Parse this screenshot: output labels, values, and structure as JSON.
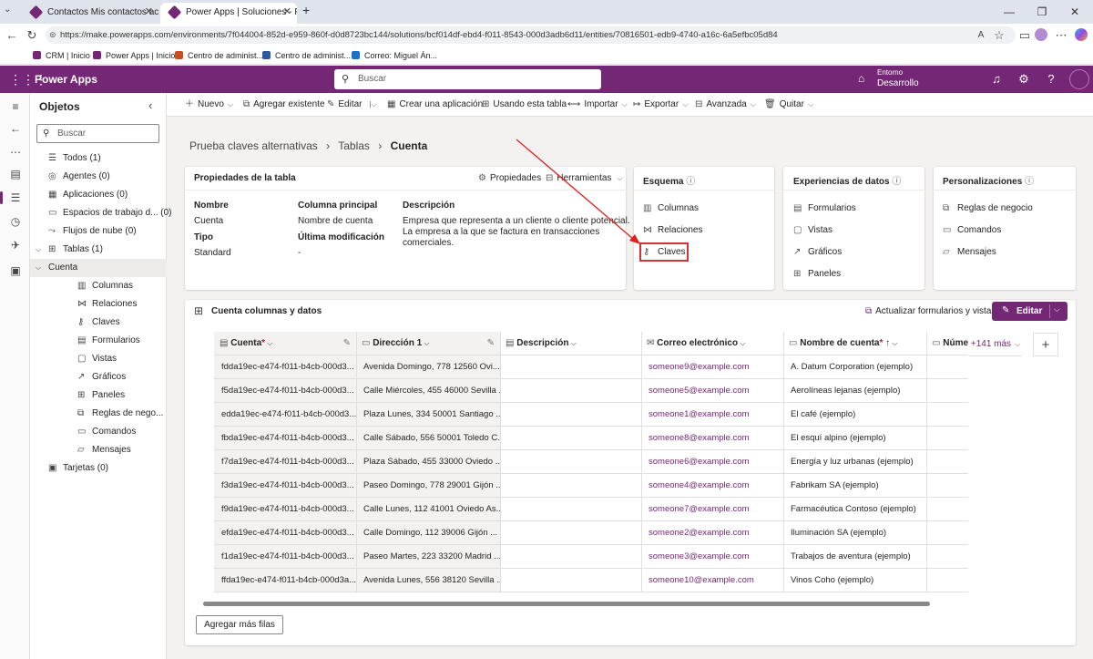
{
  "browser": {
    "tabs": [
      {
        "title": "Contactos Mis contactos activos -",
        "active": false
      },
      {
        "title": "Power Apps | Soluciones - Prueba",
        "active": true
      }
    ],
    "url": "https://make.powerapps.com/environments/7f044004-852d-e959-860f-d0d8723bc144/solutions/bcf014df-ebd4-f011-8543-000d3adb6d11/entities/70816501-edb9-4740-a16c-6a5efbc05d84",
    "bookmarks": [
      "CRM | Inicio",
      "Power Apps | Inicio",
      "Centro de administ...",
      "Centro de administ...",
      "Correo: Miguel Án..."
    ]
  },
  "header": {
    "app_name": "Power Apps",
    "search_placeholder": "Buscar",
    "env_label": "Entorno",
    "env_name": "Desarrollo",
    "accent": "#742774"
  },
  "objects": {
    "title": "Objetos",
    "search_placeholder": "Buscar",
    "items": [
      {
        "label": "Todos",
        "count": "(1)",
        "icon": "list-icon"
      },
      {
        "label": "Agentes",
        "count": "(0)",
        "icon": "agent-icon"
      },
      {
        "label": "Aplicaciones",
        "count": "(0)",
        "icon": "apps-icon"
      },
      {
        "label": "Espacios de trabajo d...",
        "count": "(0)",
        "icon": "workspace-icon"
      },
      {
        "label": "Flujos de nube",
        "count": "(0)",
        "icon": "flow-icon"
      },
      {
        "label": "Tablas",
        "count": "(1)",
        "icon": "table-icon"
      },
      {
        "label": "Cuenta",
        "count": "",
        "icon": ""
      },
      {
        "label": "Columnas",
        "count": "",
        "icon": "columns-icon"
      },
      {
        "label": "Relaciones",
        "count": "",
        "icon": "relations-icon"
      },
      {
        "label": "Claves",
        "count": "",
        "icon": "key-icon"
      },
      {
        "label": "Formularios",
        "count": "",
        "icon": "form-icon"
      },
      {
        "label": "Vistas",
        "count": "",
        "icon": "view-icon"
      },
      {
        "label": "Gráficos",
        "count": "",
        "icon": "chart-icon"
      },
      {
        "label": "Paneles",
        "count": "",
        "icon": "dashboard-icon"
      },
      {
        "label": "Reglas de nego...",
        "count": "",
        "icon": "rules-icon"
      },
      {
        "label": "Comandos",
        "count": "",
        "icon": "command-icon"
      },
      {
        "label": "Mensajes",
        "count": "",
        "icon": "message-icon"
      },
      {
        "label": "Tarjetas",
        "count": "(0)",
        "icon": "card-icon"
      }
    ]
  },
  "commands": [
    "Nuevo",
    "Agregar existente",
    "Editar",
    "Crear una aplicación",
    "Usando esta tabla",
    "Importar",
    "Exportar",
    "Avanzada",
    "Quitar"
  ],
  "breadcrumb": {
    "root": "Prueba claves alternativas",
    "mid": "Tablas",
    "current": "Cuenta"
  },
  "props_card": {
    "title": "Propiedades de la tabla",
    "btn_props": "Propiedades",
    "btn_tools": "Herramientas",
    "name_label": "Nombre",
    "name_value": "Cuenta",
    "type_label": "Tipo",
    "type_value": "Standard",
    "primary_label": "Columna principal",
    "primary_value": "Nombre de cuenta",
    "modified_label": "Última modificación",
    "modified_value": "-",
    "desc_label": "Descripción",
    "desc_lines": [
      "Empresa que representa a un cliente o cliente potencial.",
      "La empresa a la que se factura en transacciones",
      "comerciales."
    ]
  },
  "schema_card": {
    "title": "Esquema",
    "links": [
      "Columnas",
      "Relaciones",
      "Claves"
    ]
  },
  "dataexp_card": {
    "title": "Experiencias de datos",
    "links": [
      "Formularios",
      "Vistas",
      "Gráficos",
      "Paneles"
    ]
  },
  "custom_card": {
    "title": "Personalizaciones",
    "links": [
      "Reglas de negocio",
      "Comandos",
      "Mensajes"
    ]
  },
  "grid": {
    "title": "Cuenta columnas y datos",
    "update_btn": "Actualizar formularios y vistas",
    "edit_btn": "Editar",
    "more_cols": "+141 más",
    "add_rows": "Agregar más filas",
    "columns": [
      "Cuenta",
      "Dirección 1",
      "Descripción",
      "Correo electrónico",
      "Nombre de cuenta",
      "Núme"
    ],
    "rows": [
      [
        "fdda19ec-e474-f011-b4cb-000d3...",
        "Avenida Domingo, 778 12560 Ovi...",
        "",
        "someone9@example.com",
        "A. Datum Corporation (ejemplo)"
      ],
      [
        "f5da19ec-e474-f011-b4cb-000d3...",
        "Calle Miércoles, 455 46000 Sevilla ...",
        "",
        "someone5@example.com",
        "Aerolíneas lejanas (ejemplo)"
      ],
      [
        "edda19ec-e474-f011-b4cb-000d3...",
        "Plaza Lunes, 334 50001 Santiago ...",
        "",
        "someone1@example.com",
        "El café (ejemplo)"
      ],
      [
        "fbda19ec-e474-f011-b4cb-000d3...",
        "Calle Sábado, 556 50001 Toledo C...",
        "",
        "someone8@example.com",
        "El esquí alpino (ejemplo)"
      ],
      [
        "f7da19ec-e474-f011-b4cb-000d3...",
        "Plaza Sábado, 455 33000 Oviedo ...",
        "",
        "someone6@example.com",
        "Energía y luz urbanas (ejemplo)"
      ],
      [
        "f3da19ec-e474-f011-b4cb-000d3...",
        "Paseo Domingo, 778 29001 Gijón ...",
        "",
        "someone4@example.com",
        "Fabrikam SA (ejemplo)"
      ],
      [
        "f9da19ec-e474-f011-b4cb-000d3...",
        "Calle Lunes, 112 41001 Oviedo As...",
        "",
        "someone7@example.com",
        "Farmacéutica Contoso (ejemplo)"
      ],
      [
        "efda19ec-e474-f011-b4cb-000d3...",
        "Calle Domingo, 112 39006 Gijón ...",
        "",
        "someone2@example.com",
        "Iluminación SA (ejemplo)"
      ],
      [
        "f1da19ec-e474-f011-b4cb-000d3...",
        "Paseo Martes, 223 33200 Madrid ...",
        "",
        "someone3@example.com",
        "Trabajos de aventura (ejemplo)"
      ],
      [
        "ffda19ec-e474-f011-b4cb-000d3a...",
        "Avenida Lunes, 556 38120 Sevilla ...",
        "",
        "someone10@example.com",
        "Vinos Coho (ejemplo)"
      ]
    ]
  }
}
